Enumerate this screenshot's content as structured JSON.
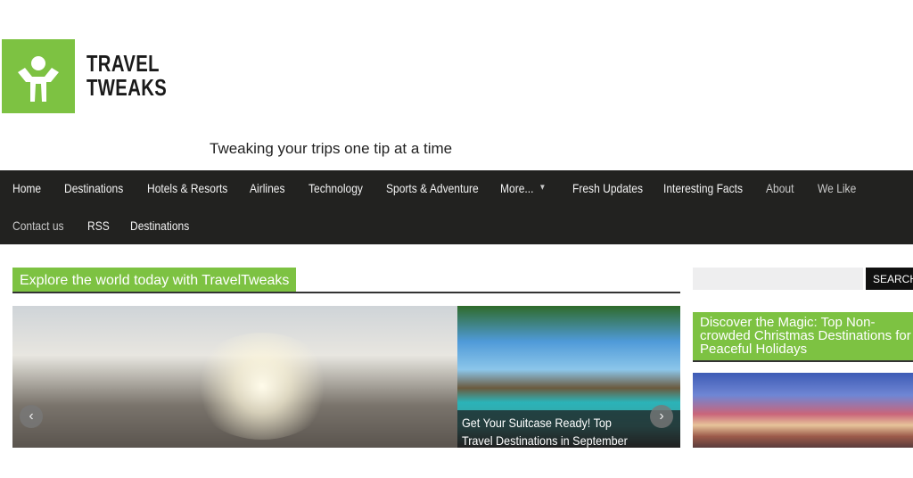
{
  "header": {
    "logo_text_line1": "TRAVEL",
    "logo_text_line2": "TWEAKS",
    "tagline": "Tweaking your trips one tip at a time"
  },
  "nav": {
    "items": [
      {
        "label": "Home"
      },
      {
        "label": "Destinations"
      },
      {
        "label": "Hotels & Resorts"
      },
      {
        "label": "Airlines"
      },
      {
        "label": "Technology"
      },
      {
        "label": "Sports & Adventure"
      },
      {
        "label": "More..."
      },
      {
        "label": "Fresh Updates"
      },
      {
        "label": "Interesting Facts"
      },
      {
        "label": "About"
      },
      {
        "label": "We Like"
      },
      {
        "label": "Contact us"
      },
      {
        "label": "RSS"
      },
      {
        "label": "Destinations"
      }
    ],
    "dropdown_icon": "▾"
  },
  "main": {
    "section_title": "Explore the world today with TravelTweaks",
    "slider": {
      "caption": "Get Your Suitcase Ready! Top Travel Destinations in September",
      "prev_icon": "‹",
      "next_icon": "›"
    }
  },
  "sidebar": {
    "search_placeholder": "",
    "search_button": "SEARCH",
    "widget_title": "Discover the Magic: Top Non-crowded Christmas Destinations for Peaceful Holidays"
  },
  "colors": {
    "brand_green": "#7dc242",
    "nav_bg": "#222220"
  }
}
